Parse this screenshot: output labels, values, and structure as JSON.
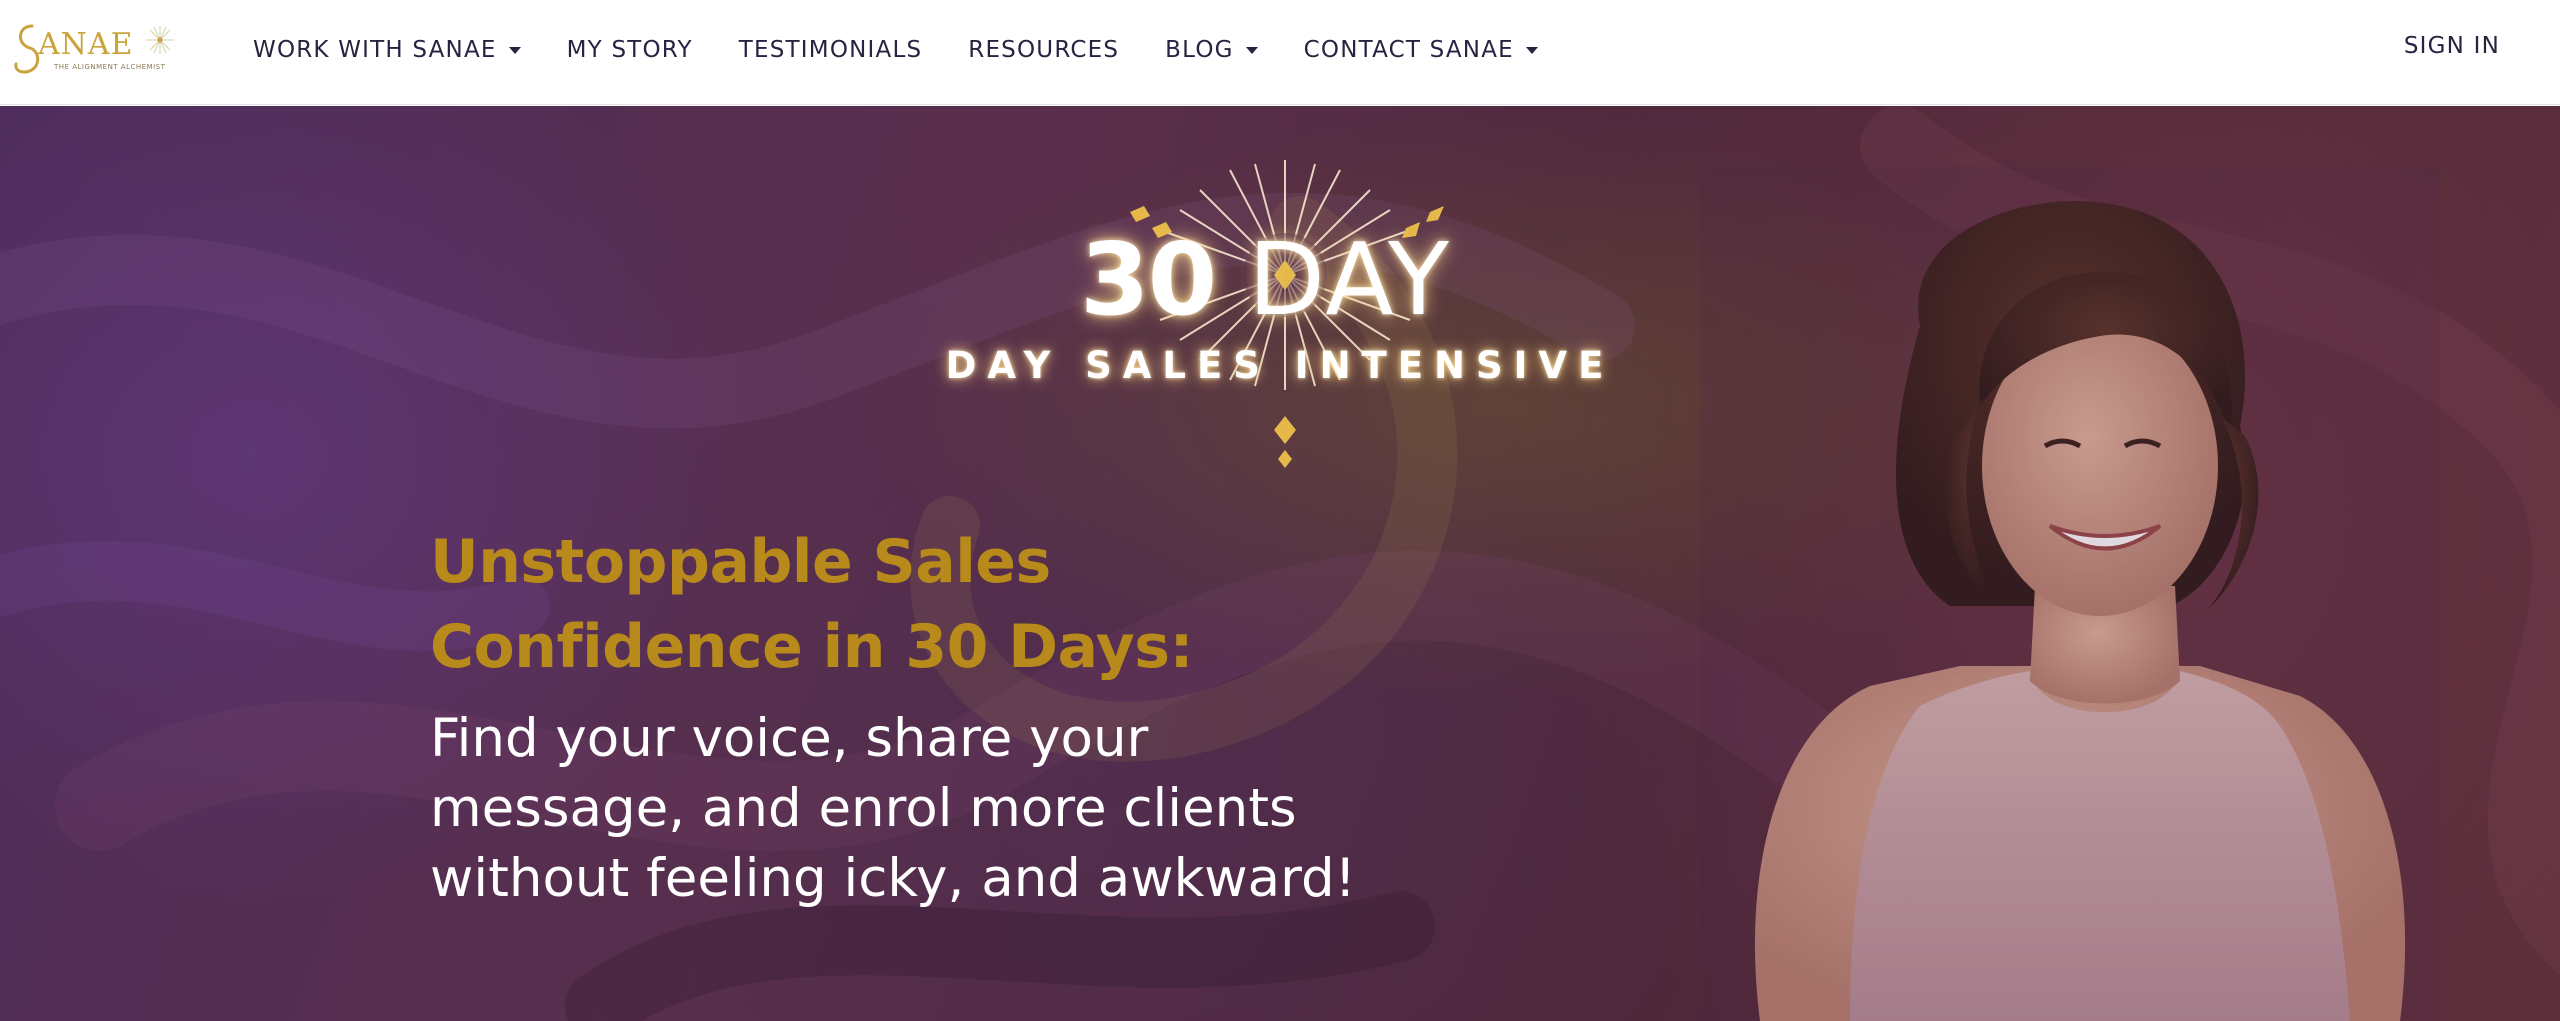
{
  "brand": {
    "logo_text": "SANAE",
    "logo_tagline": "THE ALIGNMENT ALCHEMIST",
    "accent_gold": "#b8891b",
    "nav_text_color": "#2a2240"
  },
  "nav": {
    "items": [
      {
        "label": "WORK WITH SANAE",
        "has_dropdown": true
      },
      {
        "label": "MY STORY",
        "has_dropdown": false
      },
      {
        "label": "TESTIMONIALS",
        "has_dropdown": false
      },
      {
        "label": "RESOURCES",
        "has_dropdown": false
      },
      {
        "label": "BLOG",
        "has_dropdown": true
      },
      {
        "label": "CONTACT SANAE",
        "has_dropdown": true
      }
    ],
    "sign_in": "SIGN IN"
  },
  "hero": {
    "badge": {
      "number": "30",
      "word": "DAY",
      "subtitle": "DAY SALES INTENSIVE"
    },
    "headline_lines": [
      "Unstoppable Sales",
      "Confidence in 30 Days:"
    ],
    "subheadline_lines": [
      "Find your voice, share your",
      "message, and enrol more clients",
      "without feeling icky, and awkward!"
    ],
    "image": "smiling-woman-photo"
  }
}
